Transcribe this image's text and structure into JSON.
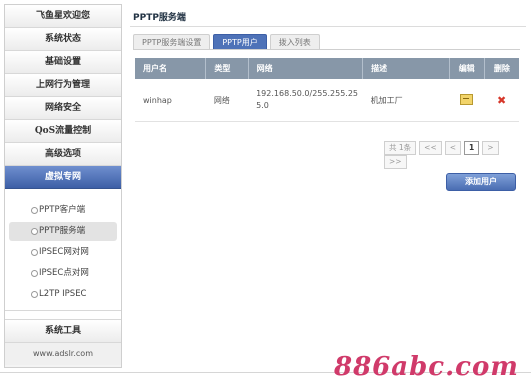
{
  "sidebar": {
    "items": [
      {
        "label": "飞鱼星欢迎您"
      },
      {
        "label": "系统状态"
      },
      {
        "label": "基础设置"
      },
      {
        "label": "上网行为管理"
      },
      {
        "label": "网络安全"
      },
      {
        "label": "QoS流量控制"
      },
      {
        "label": "高级选项"
      },
      {
        "label": "虚拟专网"
      }
    ],
    "subitems": [
      {
        "label": "PPTP客户端"
      },
      {
        "label": "PPTP服务端"
      },
      {
        "label": "IPSEC网对网"
      },
      {
        "label": "IPSEC点对网"
      },
      {
        "label": "L2TP IPSEC"
      }
    ],
    "tools_label": "系统工具",
    "footer": "www.adslr.com"
  },
  "main": {
    "title": "PPTP服务端",
    "tabs": [
      {
        "label": "PPTP服务端设置"
      },
      {
        "label": "PPTP用户"
      },
      {
        "label": "拨入列表"
      }
    ],
    "table": {
      "headers": [
        "用户名",
        "类型",
        "网络",
        "描述",
        "编辑",
        "删除"
      ],
      "rows": [
        {
          "username": "winhap",
          "type": "网络",
          "network_1": "192.168.50.0/255.255.25",
          "network_2": "5.0",
          "description": "机加工厂"
        }
      ]
    },
    "pager": {
      "total": "共 1条",
      "first": "<<",
      "prev": "<",
      "current": "1",
      "next": ">",
      "last": ">>"
    },
    "add_button": "添加用户"
  },
  "watermark": "886abc.com",
  "colors": {
    "accent": "#4e72b8",
    "header_bg": "#8797a8",
    "delete": "#d6372a",
    "watermark": "#d03a6a"
  }
}
